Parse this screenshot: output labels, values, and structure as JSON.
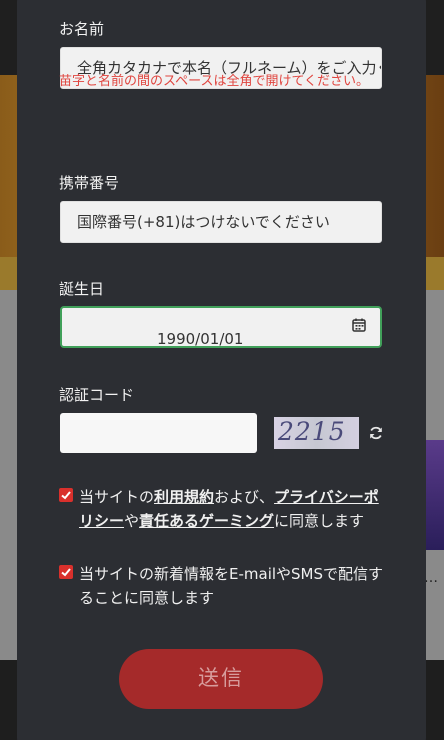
{
  "form": {
    "name_label": "お名前",
    "name_placeholder": "全角カタカナで本名（フルネーム）をご入力ください",
    "name_hint": "苗字と名前の間のスペースは全角で開けてください。",
    "phone_label": "携帯番号",
    "phone_placeholder": "国際番号(+81)はつけないでください",
    "birthday_label": "誕生日",
    "birthday_value": "1990/01/01",
    "code_label": "認証コード",
    "code_value": "",
    "captcha_text": "2215"
  },
  "agreements": {
    "terms_prefix": "当サイトの",
    "terms_link": "利用規約",
    "terms_mid": "および、",
    "privacy_link": "プライバシーポリシー",
    "terms_mid2": "や",
    "gaming_link": "責任あるゲーミング",
    "terms_suffix": "に同意します",
    "newsletter_text": "当サイトの新着情報をE-mailやSMSで配信することに同意します"
  },
  "submit_label": "送信",
  "icons": {
    "calendar": "calendar-icon",
    "refresh": "refresh-icon",
    "checkbox": "checkbox-checked-icon"
  },
  "colors": {
    "modal_bg": "#2c2e33",
    "accent_red": "#d9302c",
    "hint_red": "#e0453f",
    "focus_green": "#41a05a",
    "submit_bg": "#a52a2a"
  }
}
